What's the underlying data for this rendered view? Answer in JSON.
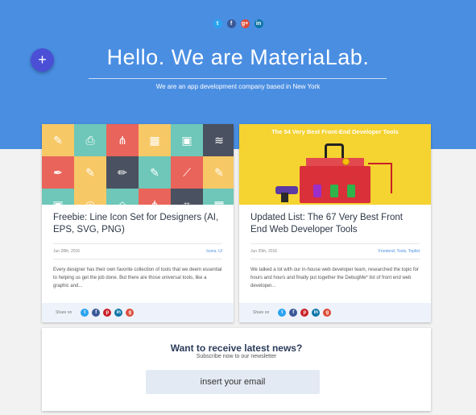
{
  "hero": {
    "title": "Hello. We are MateriaLab.",
    "subtitle": "We are an app development company based in New York",
    "social_icons": [
      "twitter-icon",
      "facebook-icon",
      "google-plus-icon",
      "linkedin-icon"
    ],
    "background_color": "#4a8ee2"
  },
  "fab": {
    "label": "+"
  },
  "posts": [
    {
      "title": "Freebie: Line Icon Set for Designers (AI, EPS, SVG, PNG)",
      "date": "Jun 28th, 2016",
      "tags": "Icons, UI",
      "excerpt": "Every designer has their own favorite collection of tools that we deem essential to helping us get the job done. But there are those universal tools, like a graphic and...",
      "share_label": "Share on"
    },
    {
      "title": "Updated List: The 67 Very Best Front End Web Developer Tools",
      "image_caption": "The 54 Very Best Front-End Developer Tools",
      "date": "Jun 25th, 2016",
      "tags": "Frontend, Tools, Toplist",
      "excerpt": "We talked a lot with our in-house web developer team, researched the topic for hours and hours and finally put together the DebugMe* list of front end web developer...",
      "share_label": "Share on"
    }
  ],
  "newsletter": {
    "title": "Want to receive latest news?",
    "subtitle": "Subscribe now to our newsletter",
    "placeholder": "insert your email"
  },
  "colors": {
    "accent": "#4a8ee2",
    "fab": "#4a4fd6",
    "tag_link": "#4a8ee2"
  }
}
